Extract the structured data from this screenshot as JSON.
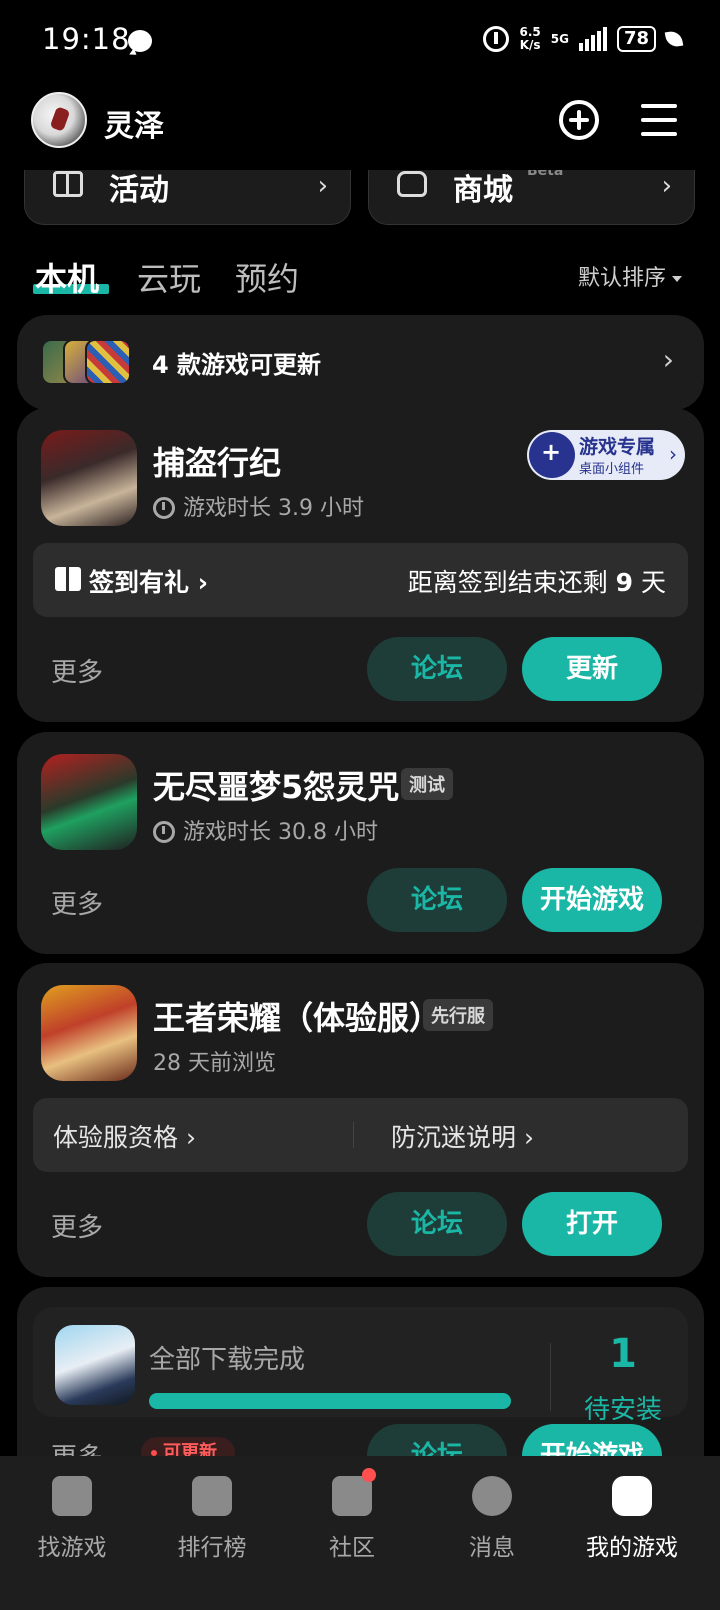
{
  "status_bar": {
    "time": "19:18",
    "net_speed_value": "6.5",
    "net_speed_unit": "K/s",
    "network": "5G",
    "battery": "78"
  },
  "header": {
    "username": "灵泽"
  },
  "quick_cards": [
    {
      "label": "活动",
      "icon": "gift-box-icon"
    },
    {
      "label": "商城",
      "badge": "Beta",
      "icon": "shop-bag-icon"
    }
  ],
  "tabs": [
    {
      "label": "本机",
      "active": true
    },
    {
      "label": "云玩",
      "active": false
    },
    {
      "label": "预约",
      "active": false
    }
  ],
  "sort": {
    "label": "默认排序"
  },
  "update_notice": {
    "text": "4 款游戏可更新"
  },
  "games": [
    {
      "title": "捕盗行纪",
      "subtitle": "游戏时长 3.9 小时",
      "widget_badge": {
        "line1": "游戏专属",
        "line2": "桌面小组件"
      },
      "signin": {
        "left": "签到有礼 ›",
        "right_prefix": "距离签到结束还剩 ",
        "right_num": "9",
        "right_suffix": " 天"
      },
      "more": "更多",
      "forum": "论坛",
      "action": "更新"
    },
    {
      "title": "无尽噩梦5怨灵咒",
      "tag": "测试",
      "subtitle": "游戏时长 30.8 小时",
      "more": "更多",
      "forum": "论坛",
      "action": "开始游戏"
    },
    {
      "title": "王者荣耀（体验服）",
      "tag": "先行服",
      "subtitle": "28 天前浏览",
      "links": {
        "left": "体验服资格 ›",
        "right": "防沉迷说明 ›"
      },
      "more": "更多",
      "forum": "论坛",
      "action": "打开"
    }
  ],
  "download": {
    "status": "全部下载完成",
    "progress": 1.0,
    "count": "1",
    "count_label": "待安装",
    "more": "更多",
    "badge": "可更新",
    "forum": "论坛",
    "action": "开始游戏"
  },
  "bottom_nav": [
    {
      "label": "找游戏",
      "icon": "find-game-icon"
    },
    {
      "label": "排行榜",
      "icon": "ranking-icon"
    },
    {
      "label": "社区",
      "icon": "community-icon",
      "notification": true
    },
    {
      "label": "消息",
      "icon": "message-icon"
    },
    {
      "label": "我的游戏",
      "icon": "my-games-icon",
      "active": true
    }
  ],
  "colors": {
    "accent": "#1ab7a6",
    "background": "#000000",
    "card": "#1c1c1c"
  }
}
